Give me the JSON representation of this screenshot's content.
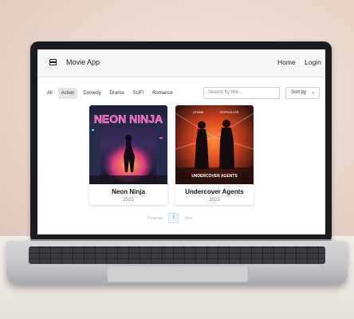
{
  "app": {
    "title": "Movie App",
    "icon": "film-icon"
  },
  "nav": {
    "home": "Home",
    "login": "Login"
  },
  "genres": [
    "All",
    "Action",
    "Comedy",
    "Drama",
    "SciFi",
    "Romance"
  ],
  "active_genre": "Action",
  "search": {
    "placeholder": "Search by title..."
  },
  "sort": {
    "label": "Sort by"
  },
  "movies": [
    {
      "title": "Neon Ninja",
      "year": "2023",
      "poster_text": "NEON NINJA"
    },
    {
      "title": "Undercover Agents",
      "year": "2023",
      "poster_text": "UNDERCOVER AGENTS",
      "poster_credits": [
        "LENNA",
        "SOPHIA LEE"
      ]
    }
  ],
  "pagination": {
    "previous": "Previous",
    "current_page": "1",
    "next": "Next"
  }
}
